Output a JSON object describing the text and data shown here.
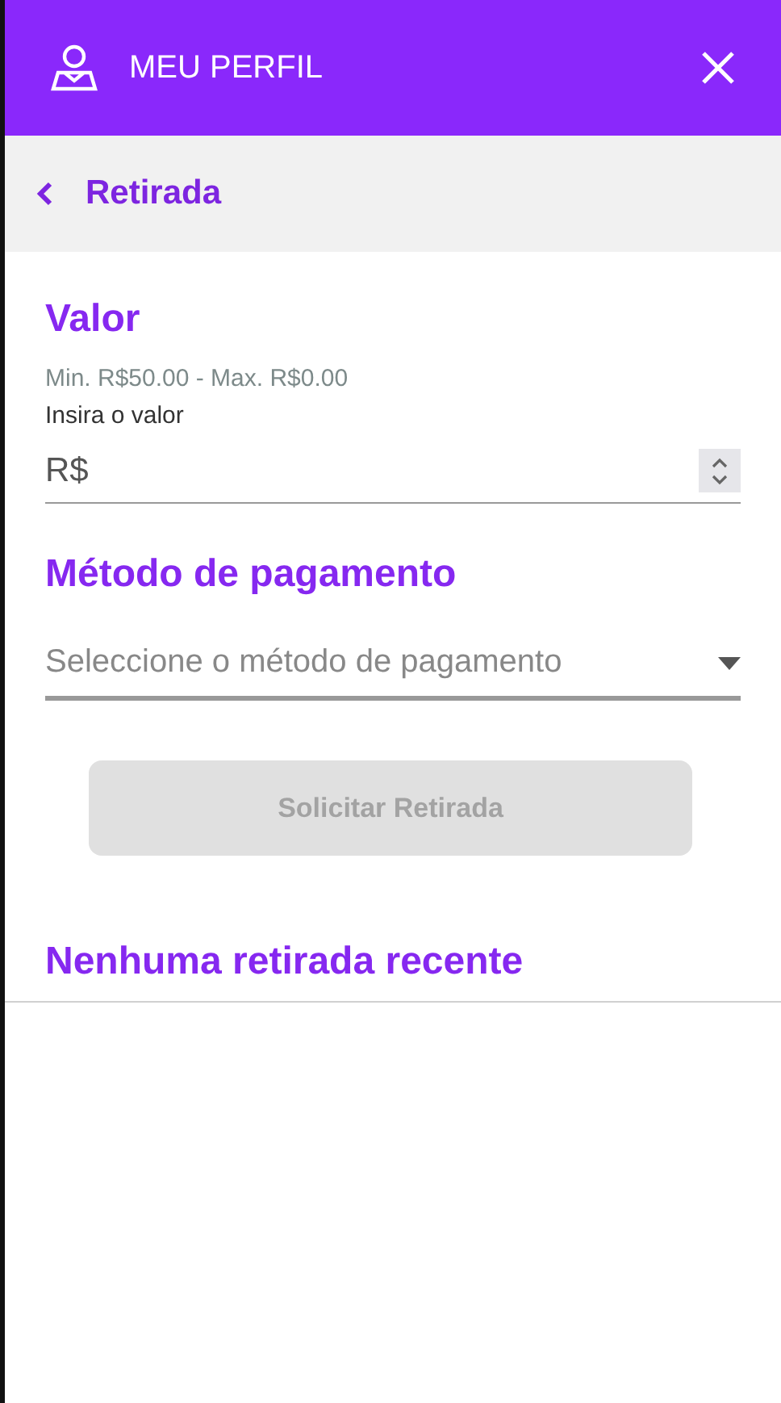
{
  "header": {
    "title": "MEU PERFIL"
  },
  "subheader": {
    "title": "Retirada"
  },
  "amount": {
    "heading": "Valor",
    "limits": "Min. R$50.00 - Max. R$0.00",
    "label": "Insira o valor",
    "prefix": "R$"
  },
  "payment": {
    "heading": "Método de pagamento",
    "placeholder": "Seleccione o método de pagamento"
  },
  "submit": {
    "label": "Solicitar Retirada",
    "disabled": true
  },
  "history": {
    "heading": "Nenhuma retirada recente"
  }
}
